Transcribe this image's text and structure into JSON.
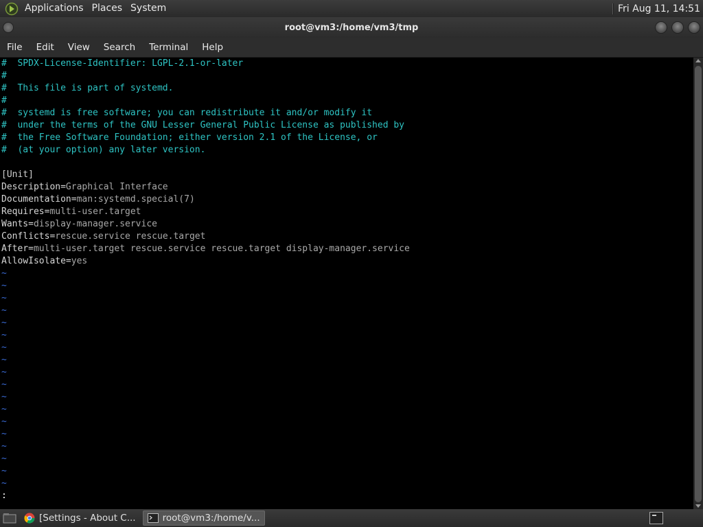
{
  "top_panel": {
    "menus": [
      "Applications",
      "Places",
      "System"
    ],
    "clock": "Fri Aug 11, 14:51"
  },
  "window": {
    "title": "root@vm3:/home/vm3/tmp"
  },
  "menubar": {
    "items": [
      "File",
      "Edit",
      "View",
      "Search",
      "Terminal",
      "Help"
    ]
  },
  "terminal": {
    "comment_lines": [
      "#  SPDX-License-Identifier: LGPL-2.1-or-later",
      "#",
      "#  This file is part of systemd.",
      "#",
      "#  systemd is free software; you can redistribute it and/or modify it",
      "#  under the terms of the GNU Lesser General Public License as published by",
      "#  the Free Software Foundation; either version 2.1 of the License, or",
      "#  (at your option) any later version."
    ],
    "section": "[Unit]",
    "entries": [
      {
        "key": "Description=",
        "value": "Graphical Interface"
      },
      {
        "key": "Documentation=",
        "value": "man:systemd.special(7)"
      },
      {
        "key": "Requires=",
        "value": "multi-user.target"
      },
      {
        "key": "Wants=",
        "value": "display-manager.service"
      },
      {
        "key": "Conflicts=",
        "value": "rescue.service rescue.target"
      },
      {
        "key": "After=",
        "value": "multi-user.target rescue.service rescue.target display-manager.service"
      },
      {
        "key": "AllowIsolate=",
        "value": "yes"
      }
    ],
    "tilde": "~",
    "tilde_count": 18,
    "command_line": ":"
  },
  "taskbar": {
    "tasks": [
      {
        "label": "[Settings - About C...",
        "icon": "chrome-icon",
        "active": false
      },
      {
        "label": "root@vm3:/home/v...",
        "icon": "terminal-icon",
        "active": true
      }
    ]
  }
}
